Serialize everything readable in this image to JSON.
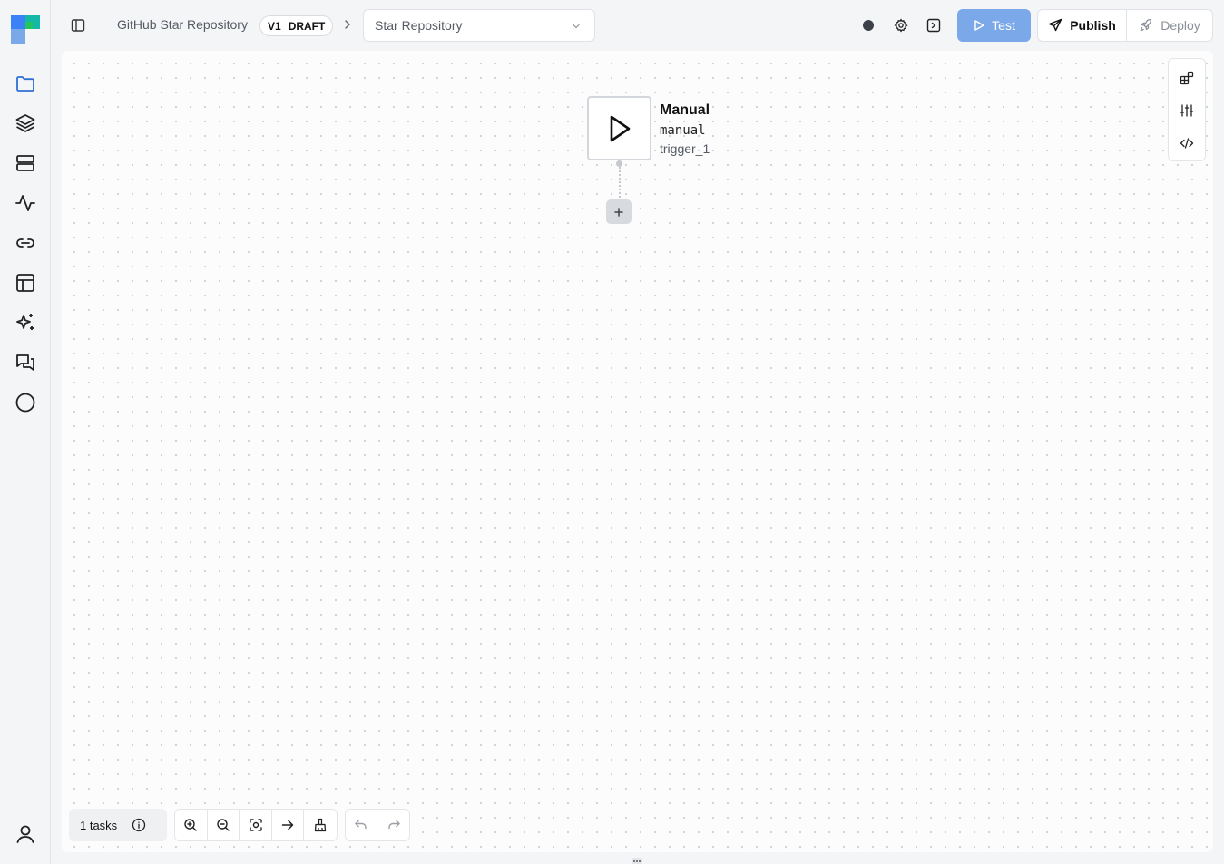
{
  "breadcrumb": {
    "flow_name": "GitHub Star Repository",
    "version": "V1",
    "state": "DRAFT"
  },
  "flow_select": {
    "value": "Star Repository"
  },
  "toolbar": {
    "test_label": "Test",
    "publish_label": "Publish",
    "deploy_label": "Deploy"
  },
  "node": {
    "title": "Manual",
    "type": "manual",
    "id": "trigger_1"
  },
  "footer": {
    "tasks_label": "1 tasks"
  },
  "colors": {
    "accent": "#2f6fd6",
    "test_button": "#7aa8e8",
    "status_dot": "#3c4148"
  },
  "icons": {
    "sidebar": [
      "folder-icon",
      "layers-icon",
      "server-icon",
      "activity-icon",
      "link-icon",
      "table-icon",
      "sparkles-icon",
      "messages-icon",
      "circle-icon",
      "user-icon"
    ],
    "right_toolbar": [
      "shapes-icon",
      "sliders-icon",
      "code-icon"
    ],
    "zoom": [
      "zoom-in-icon",
      "zoom-out-icon",
      "fit-view-icon",
      "arrow-right-icon",
      "broom-icon"
    ]
  }
}
